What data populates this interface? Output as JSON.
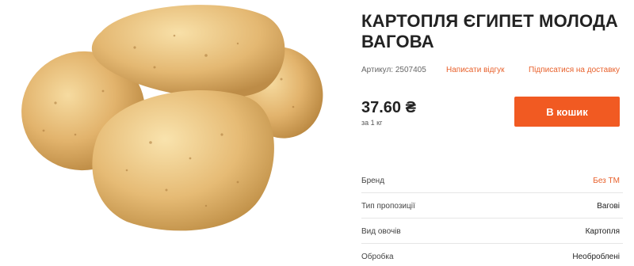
{
  "product": {
    "title": "КАРТОПЛЯ ЄГИПЕТ МОЛОДА ВАГОВА",
    "sku_text": "Артикул: 2507405",
    "review_link": "Написати відгук",
    "subscribe_link": "Підписатися на доставку",
    "price": "37.60 ₴",
    "unit": "за 1 кг",
    "buy_button": "В кошик",
    "image_icon": "potato-product-image"
  },
  "specs": [
    {
      "label": "Бренд",
      "value": "Без ТМ",
      "accent": true
    },
    {
      "label": "Тип пропозиції",
      "value": "Вагові",
      "accent": false
    },
    {
      "label": "Вид овочів",
      "value": "Картопля",
      "accent": false
    },
    {
      "label": "Обробка",
      "value": "Необроблені",
      "accent": false
    }
  ],
  "colors": {
    "accent": "#f15a22",
    "link": "#e8612c",
    "potato_skin": "#e3b874",
    "potato_shadow": "#b98a45"
  }
}
